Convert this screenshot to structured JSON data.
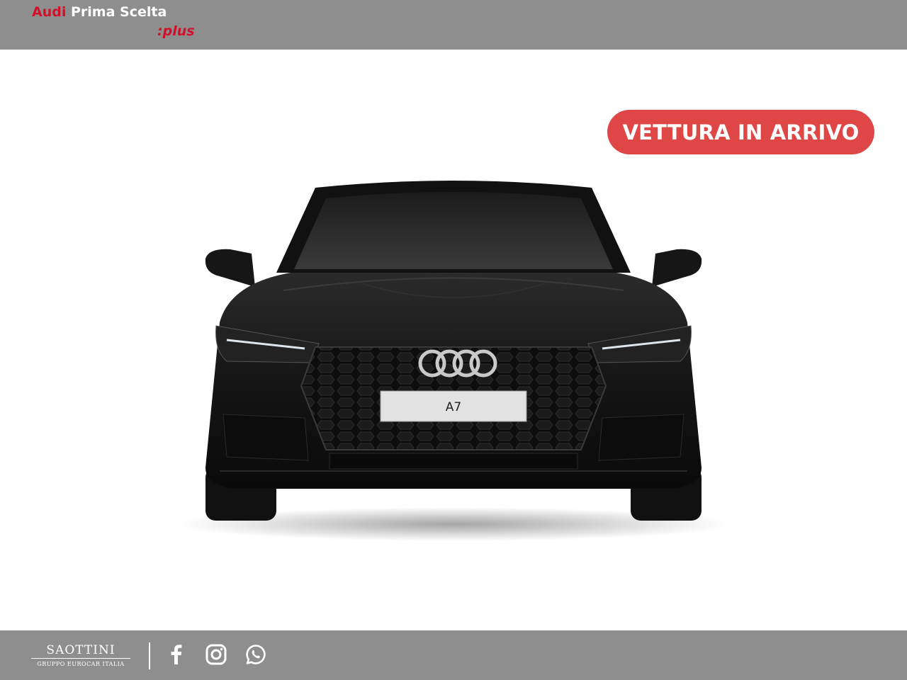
{
  "header": {
    "logo_brand": "Audi",
    "logo_program": "Prima Scelta",
    "logo_suffix": ":plus"
  },
  "main": {
    "badge_label": "VETTURA IN ARRIVO",
    "plate_text": "A7",
    "car_image_icon": "car-front-image"
  },
  "footer": {
    "dealer_name": "SAOTTINI",
    "dealer_group": "GRUPPO EUROCAR ITALIA",
    "social": [
      {
        "icon": "facebook-icon"
      },
      {
        "icon": "instagram-icon"
      },
      {
        "icon": "whatsapp-icon"
      }
    ]
  },
  "colors": {
    "bar_gray": "#8e8e8e",
    "audi_red": "#d0102a",
    "badge_red": "#df4747"
  }
}
